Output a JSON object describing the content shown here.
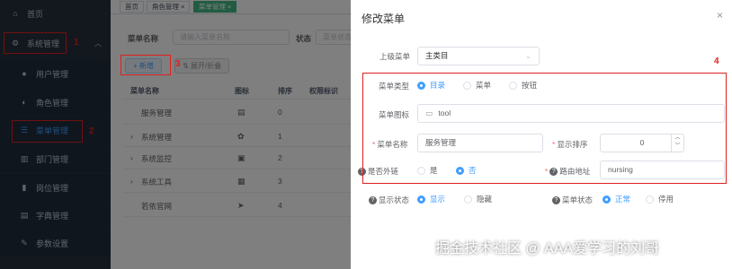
{
  "sidebar": {
    "home": "首页",
    "system": "系统管理",
    "items": [
      {
        "label": "用户管理",
        "icon": "user-icon"
      },
      {
        "label": "角色管理",
        "icon": "role-icon"
      },
      {
        "label": "菜单管理",
        "icon": "menu-tree-icon"
      },
      {
        "label": "部门管理",
        "icon": "dept-icon"
      },
      {
        "label": "岗位管理",
        "icon": "post-icon"
      },
      {
        "label": "字典管理",
        "icon": "dict-icon"
      },
      {
        "label": "参数设置",
        "icon": "settings-icon"
      }
    ]
  },
  "tabs": [
    {
      "label": "首页"
    },
    {
      "label": "角色管理",
      "close": "×"
    },
    {
      "label": "菜单管理",
      "close": "×"
    }
  ],
  "search": {
    "name_label": "菜单名称",
    "name_placeholder": "请输入菜单名称",
    "status_label": "状态",
    "status_placeholder": "菜单状态"
  },
  "toolbar": {
    "add_label": "+ 新增",
    "expand_label": "⇅ 展开/折叠"
  },
  "table": {
    "headers": [
      "菜单名称",
      "图标",
      "排序",
      "权限标识"
    ],
    "rows": [
      {
        "name": "服务管理",
        "expand": "",
        "icon": "▤",
        "order": "0"
      },
      {
        "name": "系统管理",
        "expand": "›",
        "icon": "✿",
        "order": "1"
      },
      {
        "name": "系统监控",
        "expand": "›",
        "icon": "▣",
        "order": "2"
      },
      {
        "name": "系统工具",
        "expand": "›",
        "icon": "▦",
        "order": "3"
      },
      {
        "name": "若依官网",
        "expand": "",
        "icon": "➤",
        "order": "4"
      }
    ]
  },
  "annotations": {
    "n1": "1",
    "n2": "2",
    "n3": "3",
    "n4": "4"
  },
  "dialog": {
    "title": "修改菜单",
    "close": "×",
    "parent_label": "上级菜单",
    "parent_value": "主类目",
    "type_label": "菜单类型",
    "type_options": [
      "目录",
      "菜单",
      "按钮"
    ],
    "icon_label": "菜单图标",
    "icon_value": "tool",
    "name_label": "菜单名称",
    "name_value": "服务管理",
    "order_label": "显示排序",
    "order_value": "0",
    "link_label": "是否外链",
    "link_options": [
      "是",
      "否"
    ],
    "path_label": "路由地址",
    "path_value": "nursing",
    "visible_label": "显示状态",
    "visible_options": [
      "显示",
      "隐藏"
    ],
    "status_label": "菜单状态",
    "status_options": [
      "正常",
      "停用"
    ]
  },
  "watermark": "掘金技术社区 @ AAA爱学习的刘哥",
  "colors": {
    "primary": "#409eff",
    "sidebar_bg": "#26303d",
    "annotation": "#e02020",
    "tab_active": "#42b983"
  }
}
